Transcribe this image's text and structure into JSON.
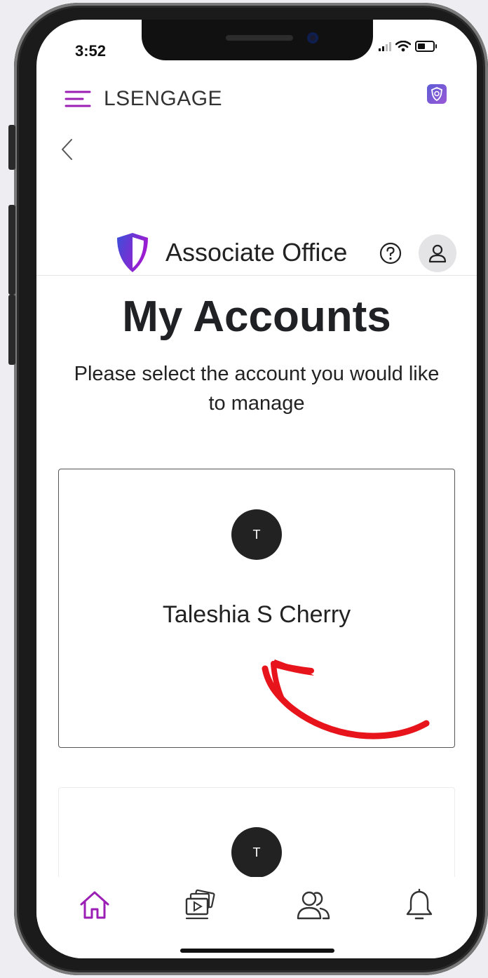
{
  "status_bar": {
    "time": "3:52"
  },
  "app_header": {
    "title": "LSENGAGE"
  },
  "brand": {
    "name": "Associate Office"
  },
  "page": {
    "title": "My Accounts",
    "subtitle": "Please select the account you would like to manage"
  },
  "accounts": [
    {
      "initial": "T",
      "name": "Taleshia S Cherry"
    },
    {
      "initial": "T",
      "name": ""
    }
  ],
  "tab_bar": {
    "items": [
      {
        "icon": "home-icon",
        "active": true
      },
      {
        "icon": "media-icon",
        "active": false
      },
      {
        "icon": "people-icon",
        "active": false
      },
      {
        "icon": "bell-icon",
        "active": false
      }
    ]
  },
  "colors": {
    "accent": "#9b1fb5",
    "annotation": "#e8141c",
    "brand_gradient_start": "#3b4fd8",
    "brand_gradient_end": "#a21ad0"
  }
}
